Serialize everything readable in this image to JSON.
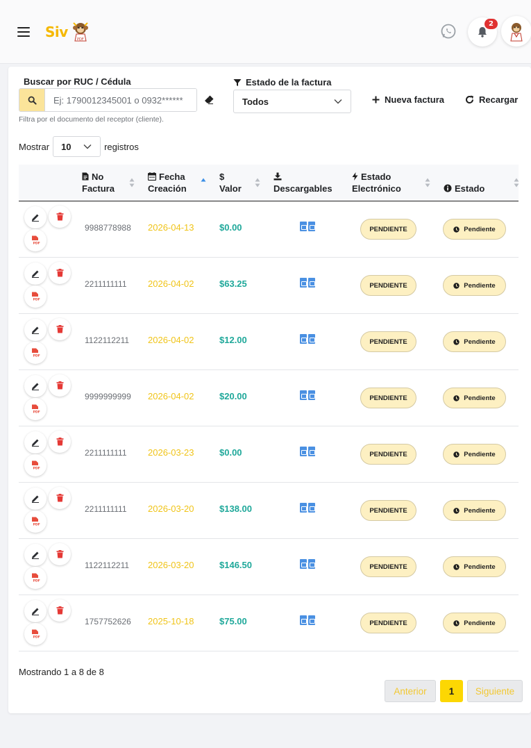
{
  "header": {
    "logo_text": "Siv",
    "notifications_count": "2"
  },
  "search": {
    "label": "Buscar por RUC / Cédula",
    "placeholder": "Ej: 1790012345001 o 0932******",
    "help": "Filtra por el documento del receptor (cliente)."
  },
  "filter": {
    "label": "Estado de la factura",
    "value": "Todos"
  },
  "actions": {
    "new_label": "Nueva factura",
    "reload_label": "Recargar"
  },
  "length": {
    "prefix": "Mostrar",
    "value": "10",
    "suffix": "registros"
  },
  "table": {
    "headers": {
      "no_factura_1": "No",
      "no_factura_2": "Factura",
      "fecha_1": "Fecha",
      "fecha_2": "Creación",
      "valor_1": "$",
      "valor_2": "Valor",
      "descargables": "Descargables",
      "estado_elec_1": "Estado",
      "estado_elec_2": "Electrónico",
      "estado": "Estado"
    },
    "rows": [
      {
        "no": "9988778988",
        "fecha": "2026-04-13",
        "valor": "$0.00",
        "estado_elec": "PENDIENTE",
        "estado": "Pendiente"
      },
      {
        "no": "2211111111",
        "fecha": "2026-04-02",
        "valor": "$63.25",
        "estado_elec": "PENDIENTE",
        "estado": "Pendiente"
      },
      {
        "no": "1122112211",
        "fecha": "2026-04-02",
        "valor": "$12.00",
        "estado_elec": "PENDIENTE",
        "estado": "Pendiente"
      },
      {
        "no": "9999999999",
        "fecha": "2026-04-02",
        "valor": "$20.00",
        "estado_elec": "PENDIENTE",
        "estado": "Pendiente"
      },
      {
        "no": "2211111111",
        "fecha": "2026-03-23",
        "valor": "$0.00",
        "estado_elec": "PENDIENTE",
        "estado": "Pendiente"
      },
      {
        "no": "2211111111",
        "fecha": "2026-03-20",
        "valor": "$138.00",
        "estado_elec": "PENDIENTE",
        "estado": "Pendiente"
      },
      {
        "no": "1122112211",
        "fecha": "2026-03-20",
        "valor": "$146.50",
        "estado_elec": "PENDIENTE",
        "estado": "Pendiente"
      },
      {
        "no": "1757752626",
        "fecha": "2025-10-18",
        "valor": "$75.00",
        "estado_elec": "PENDIENTE",
        "estado": "Pendiente"
      }
    ]
  },
  "footer": {
    "info": "Mostrando 1 a 8 de 8",
    "prev": "Anterior",
    "page": "1",
    "next": "Siguiente"
  },
  "colors": {
    "brand_yellow": "#f5b800",
    "value_teal": "#1fa89a",
    "date_yellow": "#f0c419",
    "delete_red": "#e53935",
    "download_blue": "#4a90e2",
    "pill_bg": "#fdf0c2"
  },
  "icons": {
    "menu": "hamburger-icon",
    "whatsapp": "whatsapp-icon",
    "bell": "bell-icon",
    "search": "search-icon",
    "eraser": "eraser-icon",
    "filter": "filter-icon",
    "plus": "plus-icon",
    "reload": "reload-icon",
    "edit": "pencil-icon",
    "delete": "trash-icon",
    "pdf": "pdf-icon",
    "clock": "clock-icon",
    "info": "info-icon"
  }
}
